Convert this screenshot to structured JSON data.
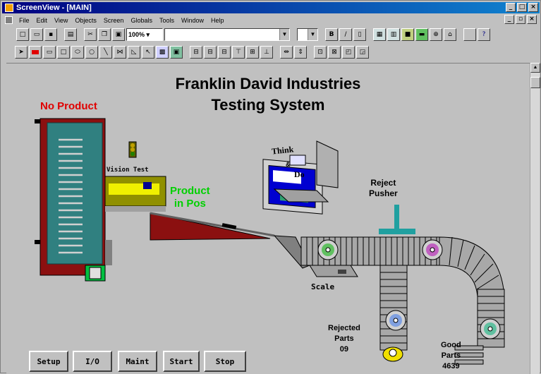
{
  "window": {
    "title": "ScreenView - [MAIN]"
  },
  "menu": [
    "File",
    "Edit",
    "View",
    "Objects",
    "Screen",
    "Globals",
    "Tools",
    "Window",
    "Help"
  ],
  "toolbar": {
    "zoom": "100%",
    "combo_value": "",
    "small_combo_value": "",
    "buttons_a": [
      "new",
      "open",
      "save",
      "print",
      "cut",
      "copy",
      "paste"
    ],
    "buttons_b": [
      "bold",
      "italic",
      "underline",
      "align",
      "align-center",
      "color",
      "fill",
      "zoom-in",
      "zoom-out",
      "help"
    ]
  },
  "drawtools": [
    "pointer",
    "rect-fill",
    "rect",
    "square",
    "ellipse",
    "circle",
    "line",
    "polyline",
    "polygon",
    "arc",
    "picture",
    "bitmap",
    "align-left",
    "align-center",
    "align-right",
    "align-top",
    "align-middle",
    "align-bottom",
    "space-h",
    "space-v",
    "group",
    "ungroup",
    "front",
    "back"
  ],
  "screen": {
    "title_line1": "Franklin David Industries",
    "title_line2": "Testing System",
    "no_product": "No Product",
    "vision_test": "Vision Test",
    "product_in_pos": [
      "Product",
      "in Pos"
    ],
    "monitor_logo": [
      "Think",
      "&",
      "Do"
    ],
    "reject_pusher": [
      "Reject",
      "Pusher"
    ],
    "scale": "Scale",
    "rejected": {
      "label": [
        "Rejected",
        "Parts"
      ],
      "count": "09"
    },
    "good": {
      "label": [
        "Good",
        "Parts"
      ],
      "count": "4639"
    }
  },
  "buttons": [
    "Setup",
    "I/O",
    "Maint",
    "Start",
    "Stop"
  ],
  "colors": {
    "title_bg": "#000080",
    "canvas": "#c0c0c0",
    "teal": "#308080",
    "red_frame": "#8b1010",
    "yellow": "#f0f000",
    "green_text": "#00d000",
    "red_text": "#e00000"
  }
}
